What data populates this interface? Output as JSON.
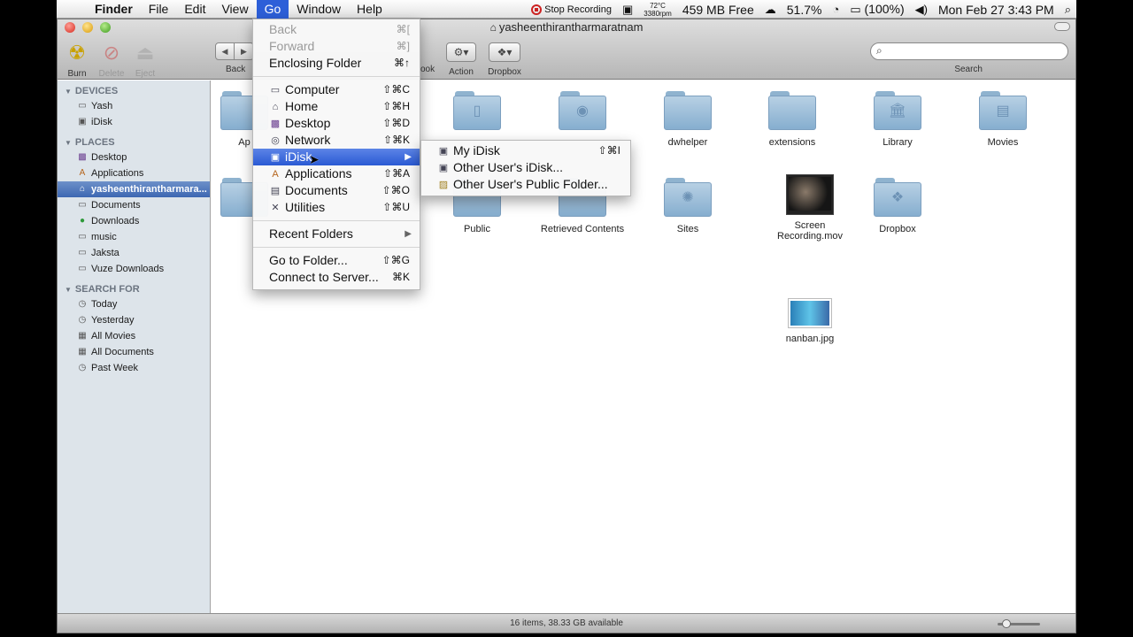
{
  "menubar": {
    "app": "Finder",
    "items": [
      "File",
      "Edit",
      "View",
      "Go",
      "Window",
      "Help"
    ],
    "active": "Go",
    "recording": "Stop Recording",
    "temp": "72°C",
    "rpm": "3380rpm",
    "memory": "459 MB Free",
    "battery_pct": "51.7%",
    "battery_full": "(100%)",
    "clock": "Mon Feb 27  3:43 PM"
  },
  "window": {
    "title": "yasheenthirantharmaratnam",
    "toolbar": {
      "burn": "Burn",
      "delete": "Delete",
      "eject": "Eject",
      "back": "Back",
      "quicklook": "ook",
      "action": "Action",
      "dropbox": "Dropbox",
      "search_label": "Search",
      "search_value": ""
    },
    "status": "16 items, 38.33 GB available",
    "zoom_level": 0.2
  },
  "sidebar": {
    "devices_header": "DEVICES",
    "devices": [
      {
        "label": "Yash",
        "icon": "hard-drive-icon"
      },
      {
        "label": "iDisk",
        "icon": "idisk-icon"
      }
    ],
    "places_header": "PLACES",
    "places": [
      {
        "label": "Desktop",
        "icon": "desktop-icon"
      },
      {
        "label": "Applications",
        "icon": "applications-icon"
      },
      {
        "label": "yasheenthirantharmara...",
        "icon": "home-icon",
        "selected": true
      },
      {
        "label": "Documents",
        "icon": "folder-icon"
      },
      {
        "label": "Downloads",
        "icon": "downloads-icon"
      },
      {
        "label": "music",
        "icon": "folder-icon"
      },
      {
        "label": "Jaksta",
        "icon": "folder-icon"
      },
      {
        "label": "Vuze Downloads",
        "icon": "folder-icon"
      }
    ],
    "search_header": "SEARCH FOR",
    "searches": [
      {
        "label": "Today",
        "icon": "clock-icon"
      },
      {
        "label": "Yesterday",
        "icon": "clock-icon"
      },
      {
        "label": "All Movies",
        "icon": "smart-folder-icon"
      },
      {
        "label": "All Documents",
        "icon": "smart-folder-icon"
      },
      {
        "label": "Past Week",
        "icon": "clock-icon"
      }
    ]
  },
  "files": {
    "apps_partial": "Ap",
    "dwhelper": "dwhelper",
    "extensions": "extensions",
    "library": "Library",
    "movies": "Movies",
    "public": "Public",
    "retrieved": "Retrieved Contents",
    "sites": "Sites",
    "screen_recording": "Screen Recording.mov",
    "dropbox": "Dropbox",
    "nanban": "nanban.jpg"
  },
  "go_menu": {
    "items": [
      {
        "label": "Back",
        "shortcut": "⌘[",
        "disabled": true
      },
      {
        "label": "Forward",
        "shortcut": "⌘]",
        "disabled": true
      },
      {
        "label": "Enclosing Folder",
        "shortcut": "⌘↑"
      },
      {
        "label": "Computer",
        "shortcut": "⇧⌘C",
        "icon": "computer-icon"
      },
      {
        "label": "Home",
        "shortcut": "⇧⌘H",
        "icon": "home-icon"
      },
      {
        "label": "Desktop",
        "shortcut": "⇧⌘D",
        "icon": "desktop-icon"
      },
      {
        "label": "Network",
        "shortcut": "⇧⌘K",
        "icon": "network-icon"
      },
      {
        "label": "iDisk",
        "submenu": true,
        "highlighted": true,
        "icon": "idisk-icon"
      },
      {
        "label": "Applications",
        "shortcut": "⇧⌘A",
        "icon": "applications-icon"
      },
      {
        "label": "Documents",
        "shortcut": "⇧⌘O",
        "icon": "documents-icon"
      },
      {
        "label": "Utilities",
        "shortcut": "⇧⌘U",
        "icon": "utilities-icon"
      },
      {
        "label": "Recent Folders",
        "submenu": true
      },
      {
        "label": "Go to Folder...",
        "shortcut": "⇧⌘G"
      },
      {
        "label": "Connect to Server...",
        "shortcut": "⌘K"
      }
    ]
  },
  "idisk_submenu": {
    "items": [
      {
        "label": "My iDisk",
        "shortcut": "⇧⌘I",
        "icon": "idisk-icon"
      },
      {
        "label": "Other User's iDisk...",
        "icon": "idisk-icon"
      },
      {
        "label": "Other User's Public Folder...",
        "icon": "public-folder-icon"
      }
    ]
  }
}
